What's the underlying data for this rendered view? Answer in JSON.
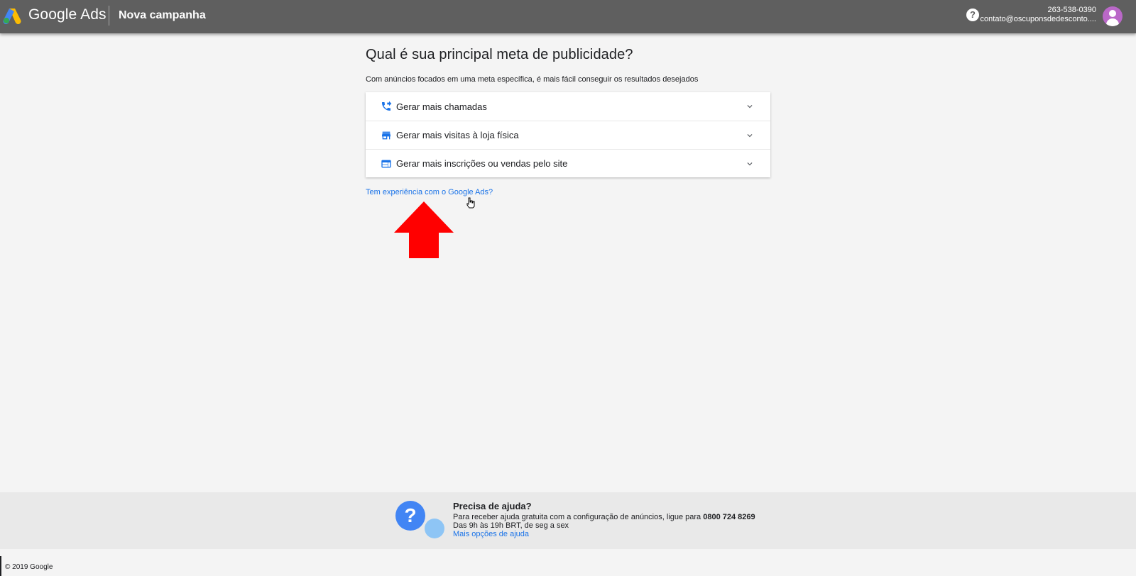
{
  "header": {
    "brand": "Google Ads",
    "campaign_title": "Nova campanha",
    "help_glyph": "?",
    "account_id": "263-538-0390",
    "account_email": "contato@oscuponsdedesconto....",
    "help_icon": "help-circle-icon",
    "avatar_icon": "person-avatar-icon"
  },
  "main": {
    "title": "Qual é sua principal meta de publicidade?",
    "subtitle": "Com anúncios focados em uma meta específica, é mais fácil conseguir os resultados desejados",
    "goals": [
      {
        "label": "Gerar mais chamadas",
        "icon": "phone-forward-icon"
      },
      {
        "label": "Gerar mais visitas à loja física",
        "icon": "store-icon"
      },
      {
        "label": "Gerar mais inscrições ou vendas pelo site",
        "icon": "web-icon"
      }
    ],
    "experience_link": "Tem experiência com o Google Ads?"
  },
  "help_footer": {
    "title": "Precisa de ajuda?",
    "line1_prefix": "Para receber ajuda gratuita com a configuração de anúncios, ligue para ",
    "phone": "0800 724 8269",
    "line2": "Das 9h às 19h BRT, de seg a sex",
    "more_link": "Mais opções de ajuda",
    "question_glyph": "?"
  },
  "footer": {
    "copyright": "© 2019 Google"
  },
  "colors": {
    "header_bg": "#5f5f5f",
    "link": "#1a73e8",
    "icon_blue": "#1a73e8",
    "arrow_red": "#ff0000",
    "avatar": "#ba68c8"
  }
}
